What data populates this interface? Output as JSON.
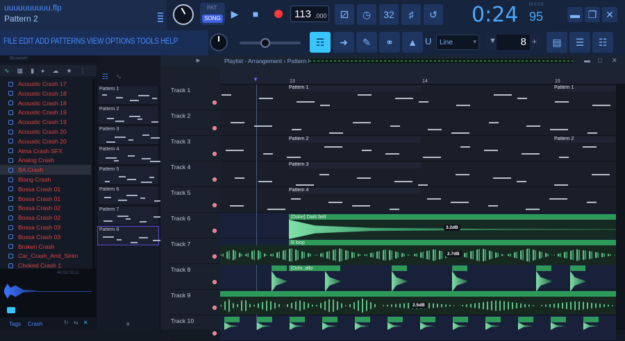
{
  "project": {
    "file_name": "uuuuuuuuuu.flp",
    "pattern_name": "Pattern 2"
  },
  "transport": {
    "pat_label": "PAT",
    "song_label": "SONG",
    "tempo": "113",
    "tempo_frac": ".000",
    "time_main": "0:24",
    "time_frac": "95",
    "time_unit": "M:S:CS"
  },
  "menu": {
    "label": "FILE EDIT ADD PATTERNS VIEW OPTIONS TOOLS HELP"
  },
  "snap": {
    "mode": "Line"
  },
  "pattern_selector": {
    "value": "8"
  },
  "browser": {
    "title": "Browser",
    "items": [
      {
        "label": "Acoustic Crash 17"
      },
      {
        "label": "Acoustic Crash 18"
      },
      {
        "label": "Acoustic Crash 18"
      },
      {
        "label": "Acoustic Crash 19"
      },
      {
        "label": "Acoustic Crash 19"
      },
      {
        "label": "Acoustic Crash 20"
      },
      {
        "label": "Acoustic Crash 20"
      },
      {
        "label": "Alma Crash SFX"
      },
      {
        "label": "Analog Crash"
      },
      {
        "label": "BA Crash"
      },
      {
        "label": "Blang Crash"
      },
      {
        "label": "Bossa Crash 01"
      },
      {
        "label": "Bossa Crash 01"
      },
      {
        "label": "Bossa Crash 02"
      },
      {
        "label": "Bossa Crash 02"
      },
      {
        "label": "Bossa Crash 03"
      },
      {
        "label": "Bossa Crash 03"
      },
      {
        "label": "Broken Crash"
      },
      {
        "label": "Car_Crash_And_Siren"
      },
      {
        "label": "Choked Crash 1"
      }
    ],
    "preview_time": "44:03/1:52:12",
    "footer_tag_1": "Tags",
    "footer_tag_2": "Crash"
  },
  "patterns": [
    {
      "label": "Pattern 1"
    },
    {
      "label": "Pattern 2"
    },
    {
      "label": "Pattern 3"
    },
    {
      "label": "Pattern 4"
    },
    {
      "label": "Pattern 5"
    },
    {
      "label": "Pattern 6"
    },
    {
      "label": "Pattern 7"
    },
    {
      "label": "Pattern 8"
    }
  ],
  "playlist": {
    "title": "Playlist - Arrangement › Pattern 8",
    "bars": [
      "13",
      "14",
      "15"
    ],
    "tracks": [
      {
        "label": "Track 1"
      },
      {
        "label": "Track 2"
      },
      {
        "label": "Track 3"
      },
      {
        "label": "Track 4"
      },
      {
        "label": "Track 5"
      },
      {
        "label": "Track 6"
      },
      {
        "label": "Track 7"
      },
      {
        "label": "Track 8"
      },
      {
        "label": "Track 9"
      },
      {
        "label": "Track 10"
      }
    ],
    "clips": {
      "pattern1_a": "Pattern 1",
      "pattern1_b": "Pattern 1",
      "pattern2_a": "Pattern 2",
      "pattern2_b": "Pattern 2",
      "pattern3": "Pattern 3",
      "pattern4": "Pattern 4",
      "dark_bell": "[Dolor] Dark bell",
      "lil_loop": "lil loop",
      "dolo_allo": "[Dolo..allo"
    },
    "levels": {
      "t6": "3.2dB",
      "t7": "2.7dB",
      "t9": "2.5dB"
    }
  },
  "colors": {
    "accent": "#39c6ff",
    "audio_clip": "#2e9a5a",
    "browser_item": "#e04242",
    "time": "#4aa8ff"
  }
}
